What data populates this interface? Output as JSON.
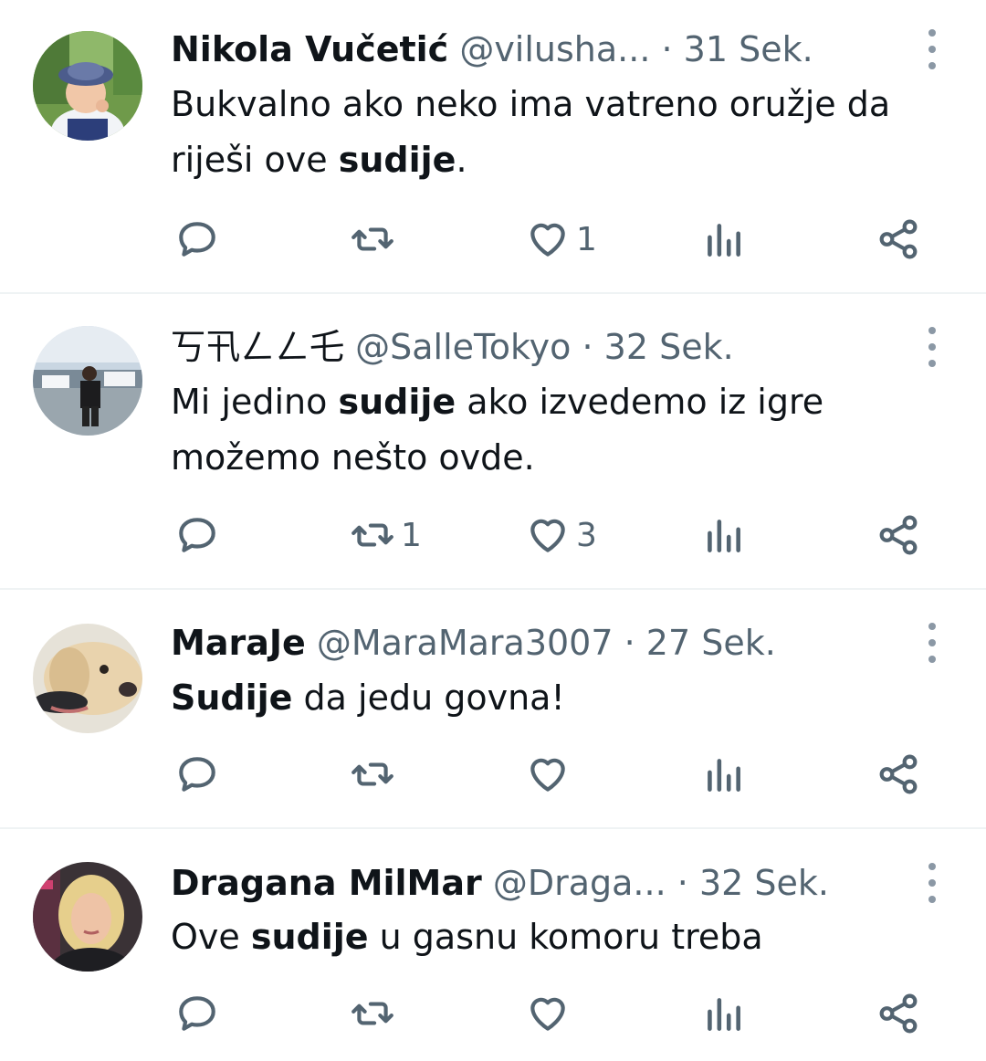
{
  "colors": {
    "text": "#0f1419",
    "muted": "#536471",
    "divider": "#eff3f4"
  },
  "tweets": [
    {
      "name": "Nikola Vučetić",
      "handle": "@vilusha...",
      "sep": " · ",
      "time": "31 Sek.",
      "text_pre": "Bukvalno ako neko ima vatreno oružje da riješi ove ",
      "text_bold": "sudije",
      "text_post": ".",
      "counts": {
        "reply": "",
        "retweet": "",
        "like": "1"
      },
      "avatar": "avatar-child-in-hat"
    },
    {
      "name": "丂卂ㄥㄥ乇",
      "handle": "@SalleTokyo",
      "sep": " · ",
      "time": "32 Sek.",
      "text_pre": "Mi jedino ",
      "text_bold": "sudije",
      "text_post": " ako izvedemo iz igre možemo nešto ovde.",
      "counts": {
        "reply": "",
        "retweet": "1",
        "like": "3"
      },
      "avatar": "avatar-man-on-boat"
    },
    {
      "name": "MaraJe",
      "handle": "@MaraMara3007",
      "sep": " · ",
      "time": "27 Sek.",
      "text_pre": "",
      "text_bold": "Sudije",
      "text_post": " da jedu govna!",
      "counts": {
        "reply": "",
        "retweet": "",
        "like": ""
      },
      "avatar": "avatar-dog"
    },
    {
      "name": "Dragana MilMar",
      "handle": "@Draga...",
      "sep": " · ",
      "time": "32 Sek.",
      "text_pre": "Ove ",
      "text_bold": "sudije",
      "text_post": " u gasnu komoru treba",
      "counts": {
        "reply": "",
        "retweet": "",
        "like": ""
      },
      "avatar": "avatar-woman-blonde"
    }
  ]
}
